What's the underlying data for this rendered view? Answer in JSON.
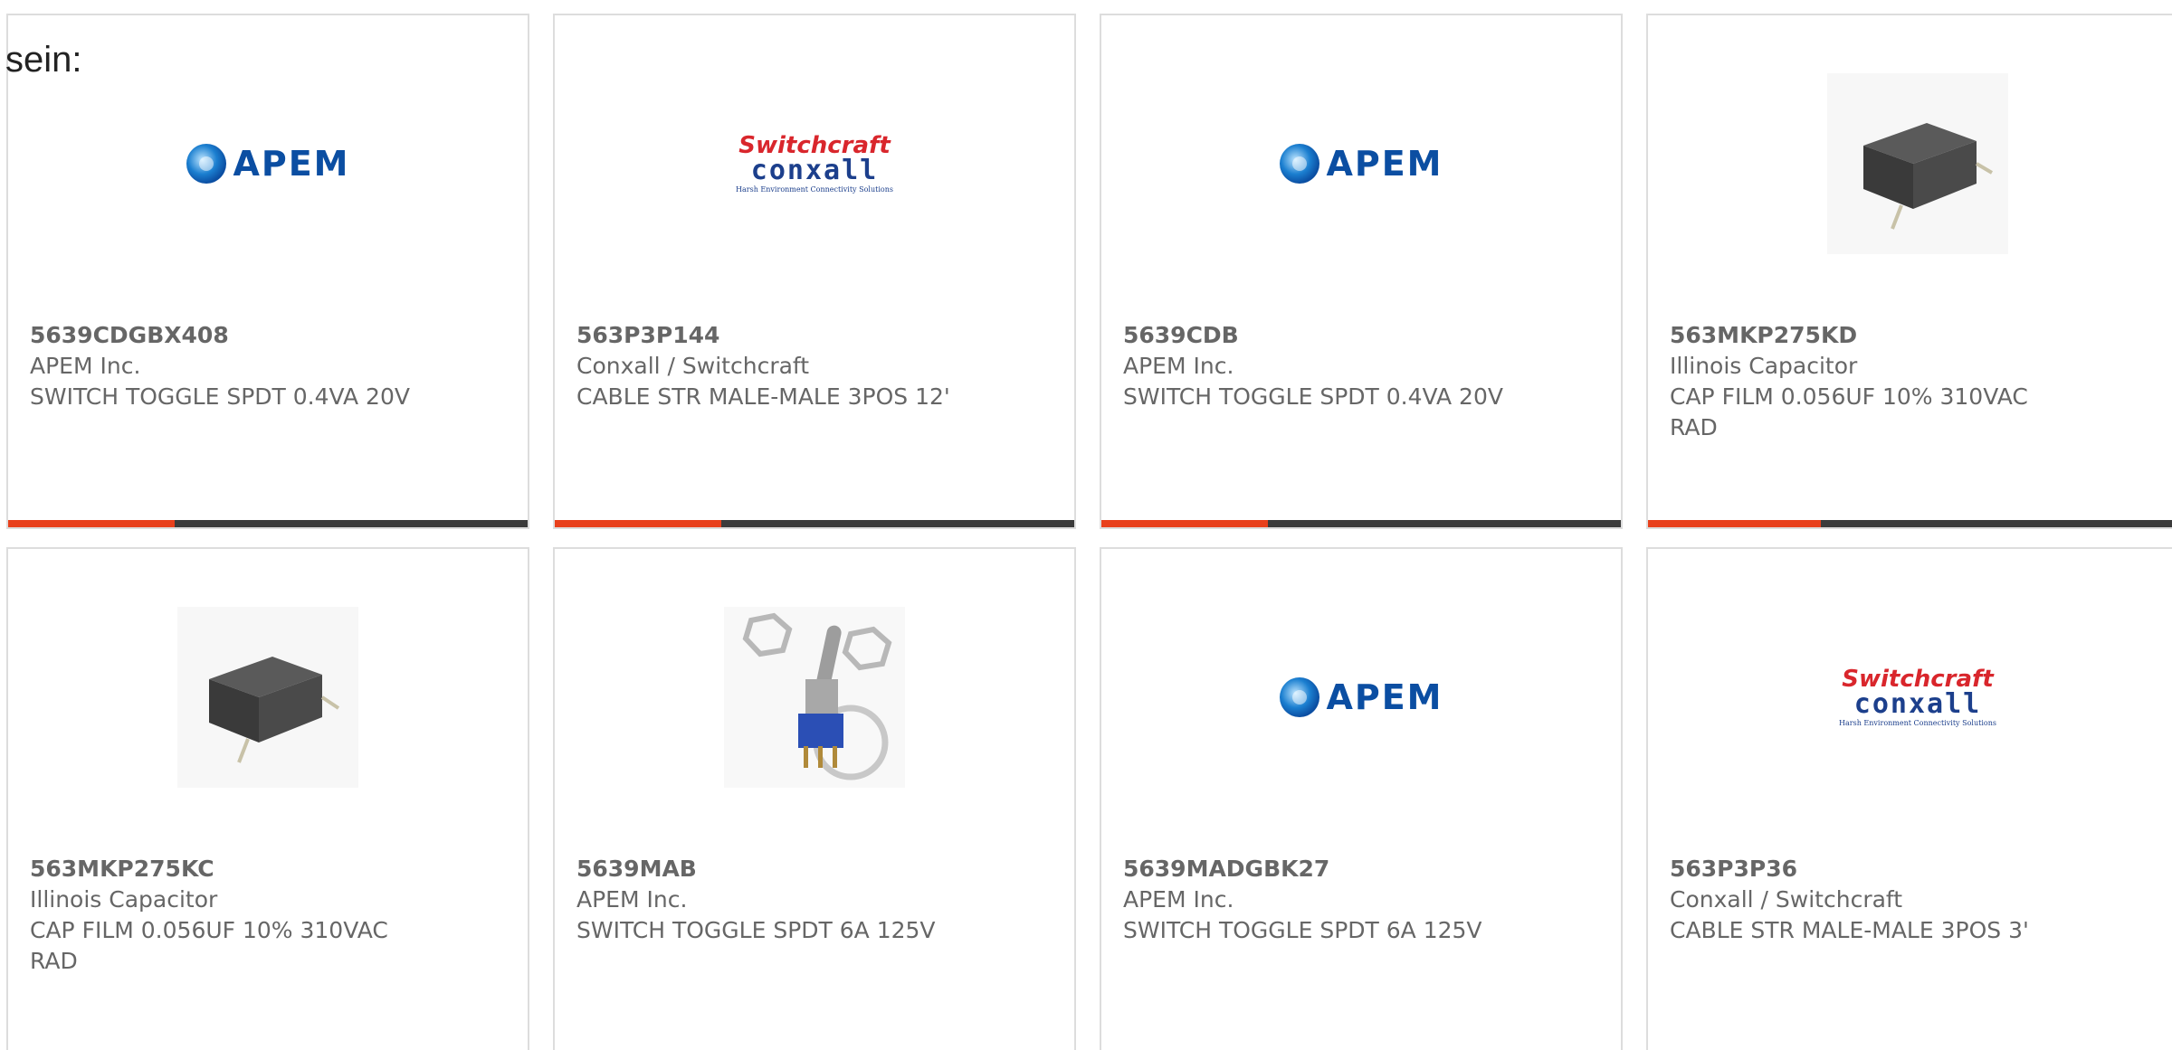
{
  "header": {
    "text": "sein:"
  },
  "colors": {
    "accent": "#e8401c",
    "track": "#3b3b3b",
    "text": "#666666",
    "border": "#dddddd"
  },
  "logos": {
    "apem": "APEM",
    "switchcraft_top": "Switchcraft",
    "switchcraft_mid": "conxall",
    "switchcraft_tag": "Harsh Environment Connectivity Solutions"
  },
  "products": [
    {
      "part": "5639CDGBX408",
      "manufacturer": "APEM Inc.",
      "description": "SWITCH TOGGLE SPDT 0.4VA 20V",
      "image": "apem-logo",
      "progress": 0.32
    },
    {
      "part": "563P3P144",
      "manufacturer": "Conxall / Switchcraft",
      "description": "CABLE STR MALE-MALE 3POS 12'",
      "image": "switchcraft-logo",
      "progress": 0.32
    },
    {
      "part": "5639CDB",
      "manufacturer": "APEM Inc.",
      "description": "SWITCH TOGGLE SPDT 0.4VA 20V",
      "image": "apem-logo",
      "progress": 0.32
    },
    {
      "part": "563MKP275KD",
      "manufacturer": "Illinois Capacitor",
      "description": "CAP FILM 0.056UF 10% 310VAC RAD",
      "image": "capacitor-photo",
      "progress": 0.32
    },
    {
      "part": "563MKP275KC",
      "manufacturer": "Illinois Capacitor",
      "description": "CAP FILM 0.056UF 10% 310VAC RAD",
      "image": "capacitor-photo"
    },
    {
      "part": "5639MAB",
      "manufacturer": "APEM Inc.",
      "description": "SWITCH TOGGLE SPDT 6A 125V",
      "image": "toggle-switch-photo"
    },
    {
      "part": "5639MADGBK27",
      "manufacturer": "APEM Inc.",
      "description": "SWITCH TOGGLE SPDT 6A 125V",
      "image": "apem-logo"
    },
    {
      "part": "563P3P36",
      "manufacturer": "Conxall / Switchcraft",
      "description": "CABLE STR MALE-MALE 3POS 3'",
      "image": "switchcraft-logo"
    }
  ]
}
